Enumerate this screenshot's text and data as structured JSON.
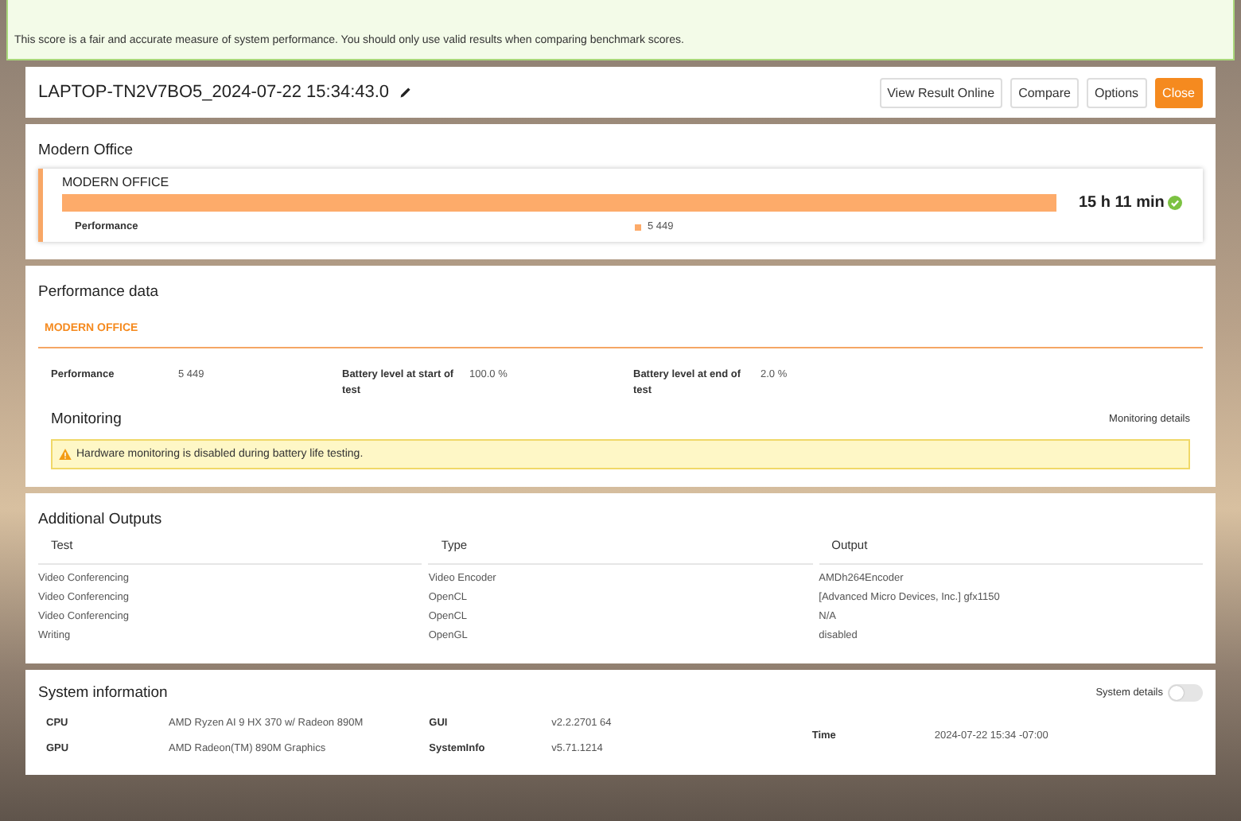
{
  "banner": {
    "message": "This score is a fair and accurate measure of system performance. You should only use valid results when comparing benchmark scores."
  },
  "header": {
    "title": "LAPTOP-TN2V7BO5_2024-07-22 15:34:43.0",
    "buttons": [
      {
        "label": "View Result Online",
        "primary": false
      },
      {
        "label": "Compare",
        "primary": false
      },
      {
        "label": "Options",
        "primary": false
      },
      {
        "label": "Close",
        "primary": true
      }
    ]
  },
  "score": {
    "title": "Modern Office",
    "test": "MODERN OFFICE",
    "result": "15 h 11 min",
    "valid": true,
    "metric": "Performance",
    "metric_value": "5 449"
  },
  "performance_data": {
    "title": "Performance data",
    "tab": "MODERN OFFICE",
    "fields": [
      {
        "label": "Performance",
        "value": "5 449"
      },
      {
        "label": "Battery level at start of test",
        "value": "100.0 %"
      },
      {
        "label": "Battery level at end of test",
        "value": "2.0 %"
      }
    ],
    "monitoring": {
      "title": "Monitoring",
      "link": "Monitoring details",
      "warning": "Hardware monitoring is disabled during battery life testing."
    }
  },
  "additional_outputs": {
    "title": "Additional Outputs",
    "columns": [
      "Test",
      "Type",
      "Output"
    ],
    "rows": [
      [
        "Video Conferencing",
        "Video Encoder",
        "AMDh264Encoder"
      ],
      [
        "Video Conferencing",
        "OpenCL",
        "[Advanced Micro Devices, Inc.] gfx1150"
      ],
      [
        "Video Conferencing",
        "OpenCL",
        "N/A"
      ],
      [
        "Writing",
        "OpenGL",
        "disabled"
      ]
    ]
  },
  "system_information": {
    "title": "System information",
    "details_label": "System details",
    "details_on": false,
    "columns": [
      [
        {
          "label": "CPU",
          "value": "AMD Ryzen AI 9 HX 370 w/ Radeon 890M"
        },
        {
          "label": "GPU",
          "value": "AMD Radeon(TM) 890M Graphics"
        }
      ],
      [
        {
          "label": "GUI",
          "value": "v2.2.2701 64"
        },
        {
          "label": "SystemInfo",
          "value": "v5.71.1214"
        }
      ],
      [
        {
          "label": "Time",
          "value": "2024-07-22 15:34 -07:00"
        }
      ]
    ]
  }
}
